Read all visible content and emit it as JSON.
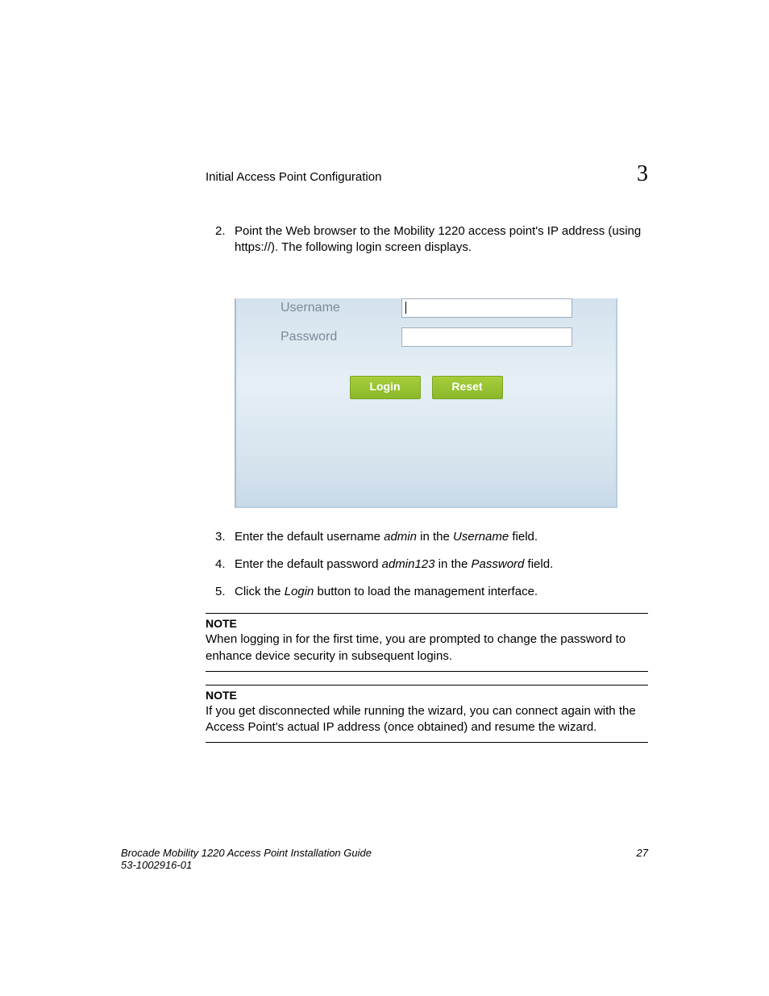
{
  "header": {
    "section_title": "Initial Access Point Configuration",
    "chapter_number": "3"
  },
  "steps": {
    "s2": {
      "num": "2.",
      "text_before": "Point the Web browser to the Mobility 1220 access point's IP address (using https://). The following login screen displays."
    },
    "s3": {
      "num": "3.",
      "prefix": "Enter the default username ",
      "em1": "admin",
      "mid": " in the ",
      "em2": "Username",
      "suffix": " field."
    },
    "s4": {
      "num": "4.",
      "prefix": "Enter the default password ",
      "em1": "admin123",
      "mid": " in the ",
      "em2": "Password",
      "suffix": " field."
    },
    "s5": {
      "num": "5.",
      "prefix": "Click the ",
      "em1": "Login",
      "suffix": " button to load the management interface."
    }
  },
  "login": {
    "username_label": "Username",
    "password_label": "Password",
    "username_value": "",
    "password_value": "",
    "login_button": "Login",
    "reset_button": "Reset"
  },
  "notes": {
    "n1": {
      "heading": "NOTE",
      "body": "When logging in for the first time, you are prompted to change the password to enhance device security in subsequent logins."
    },
    "n2": {
      "heading": "NOTE",
      "body": "If you get disconnected while running the wizard, you can connect again with the Access Point's actual IP address (once obtained) and resume the wizard."
    }
  },
  "footer": {
    "guide_title": "Brocade Mobility 1220 Access Point Installation Guide",
    "doc_id": "53-1002916-01",
    "page_number": "27"
  }
}
